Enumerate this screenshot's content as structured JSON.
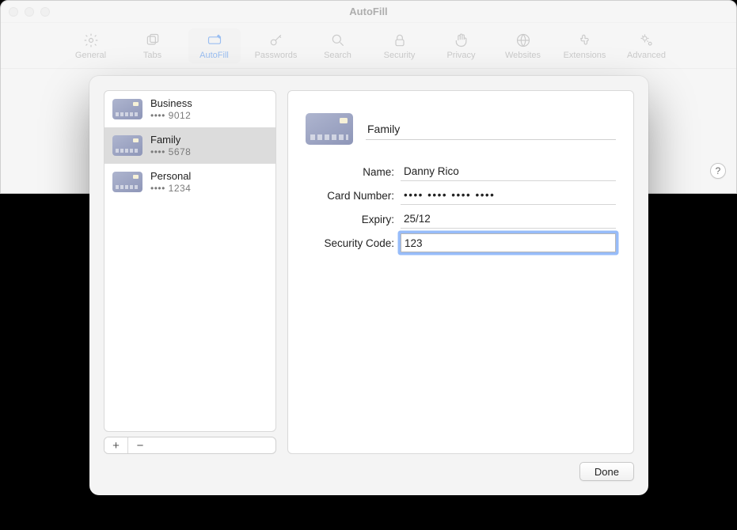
{
  "window": {
    "title": "AutoFill"
  },
  "toolbar": {
    "items": [
      {
        "id": "general",
        "label": "General"
      },
      {
        "id": "tabs",
        "label": "Tabs"
      },
      {
        "id": "autofill",
        "label": "AutoFill",
        "selected": true
      },
      {
        "id": "passwords",
        "label": "Passwords"
      },
      {
        "id": "search",
        "label": "Search"
      },
      {
        "id": "security",
        "label": "Security"
      },
      {
        "id": "privacy",
        "label": "Privacy"
      },
      {
        "id": "websites",
        "label": "Websites"
      },
      {
        "id": "extensions",
        "label": "Extensions"
      },
      {
        "id": "advanced",
        "label": "Advanced"
      }
    ]
  },
  "help_label": "?",
  "cards": [
    {
      "name": "Business",
      "masked": "•••• 9012",
      "selected": false
    },
    {
      "name": "Family",
      "masked": "•••• 5678",
      "selected": true
    },
    {
      "name": "Personal",
      "masked": "•••• 1234",
      "selected": false
    }
  ],
  "list_controls": {
    "add": "+",
    "remove": "−"
  },
  "detail": {
    "title_value": "Family",
    "fields": {
      "name": {
        "label": "Name:",
        "value": "Danny Rico"
      },
      "card_number": {
        "label": "Card Number:",
        "value": "•••• •••• •••• ••••"
      },
      "expiry": {
        "label": "Expiry:",
        "value": "25/12"
      },
      "security_code": {
        "label": "Security Code:",
        "value": "123",
        "focused": true
      }
    }
  },
  "footer": {
    "done": "Done"
  }
}
